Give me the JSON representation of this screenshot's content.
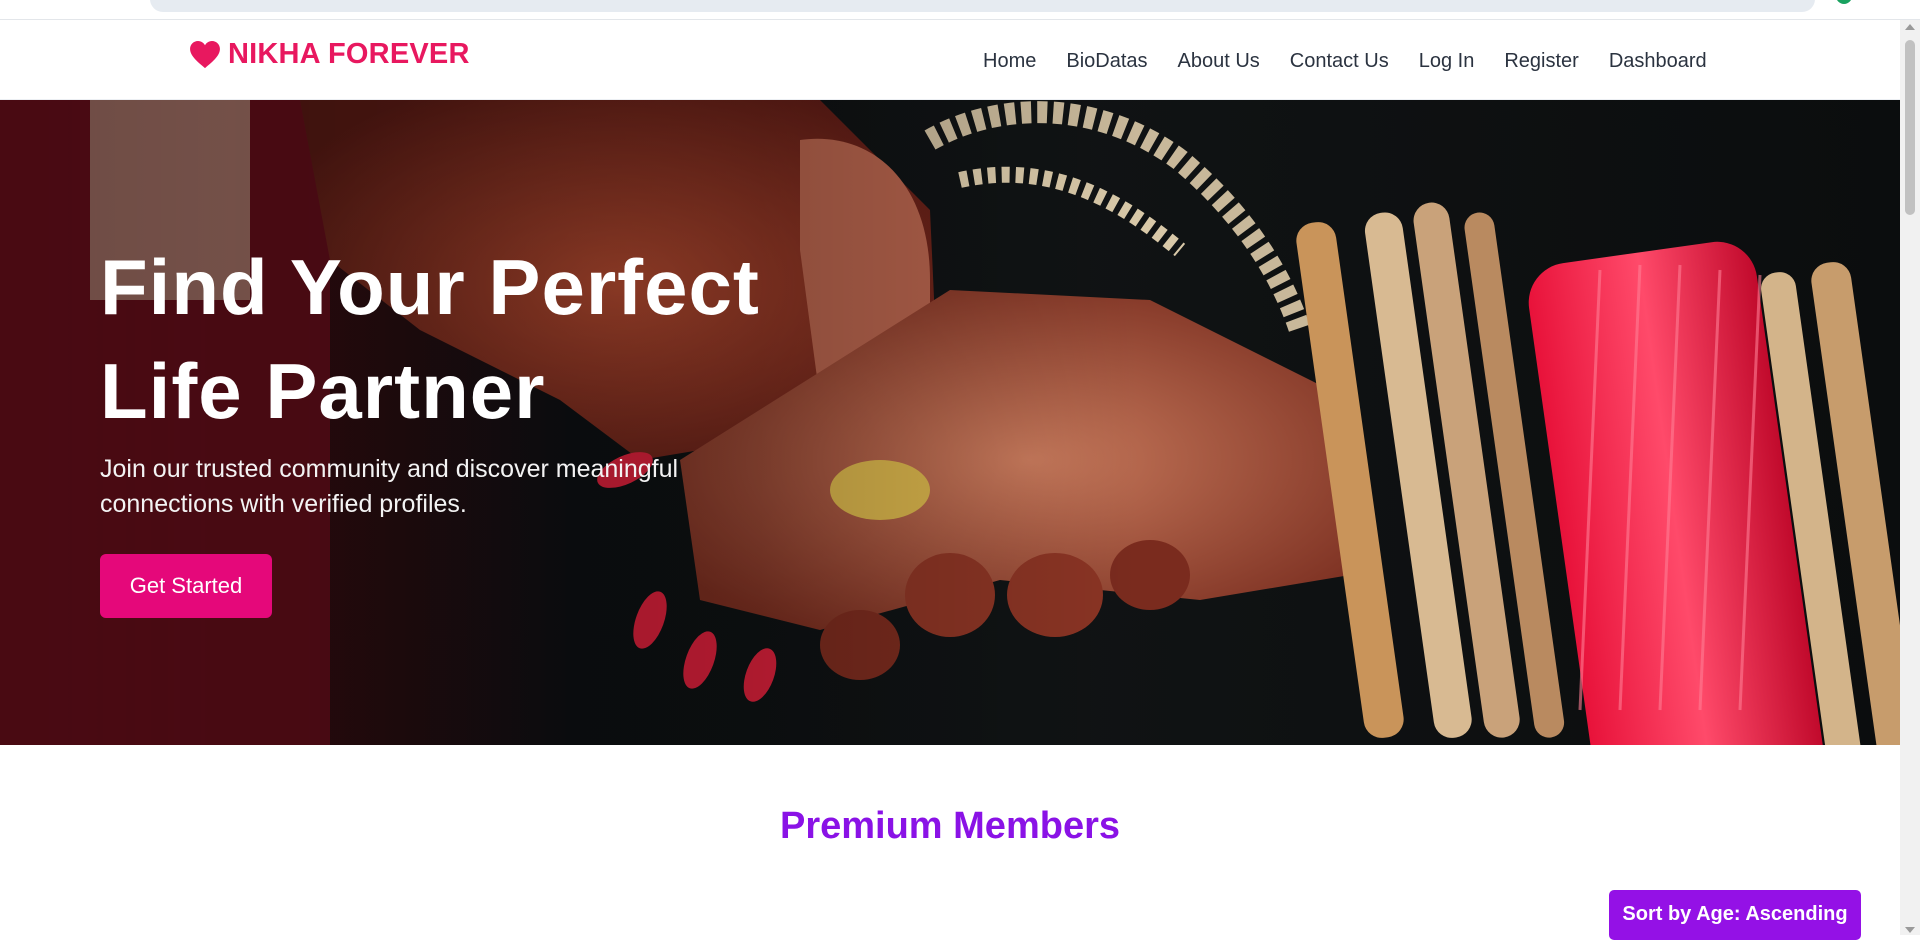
{
  "brand": {
    "name": "NIKHA FOREVER",
    "icon": "heart-icon",
    "color": "#e8185f"
  },
  "nav": {
    "items": [
      {
        "label": "Home"
      },
      {
        "label": "BioDatas"
      },
      {
        "label": "About Us"
      },
      {
        "label": "Contact Us"
      },
      {
        "label": "Log In"
      },
      {
        "label": "Register"
      },
      {
        "label": "Dashboard"
      }
    ]
  },
  "hero": {
    "title_line1": "Find Your Perfect",
    "title_line2": "Life Partner",
    "subtitle_line1": "Join our trusted community and discover meaningful",
    "subtitle_line2": "connections with verified profiles.",
    "cta_label": "Get Started",
    "cta_color": "#e5087a"
  },
  "premium": {
    "title": "Premium Members",
    "title_color": "#8a12e6",
    "sort_label": "Sort by Age: Ascending",
    "sort_color": "#9411e6"
  }
}
